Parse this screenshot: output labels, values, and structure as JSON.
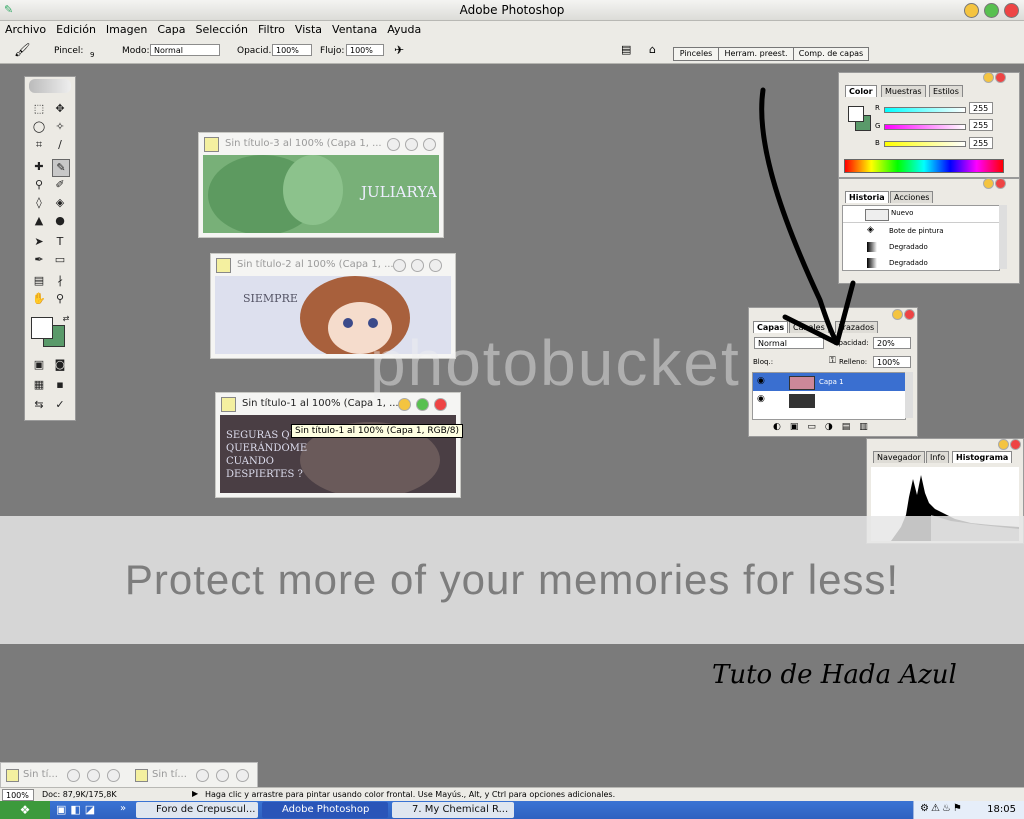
{
  "app": {
    "title": "Adobe Photoshop"
  },
  "menu": [
    "Archivo",
    "Edición",
    "Imagen",
    "Capa",
    "Selección",
    "Filtro",
    "Vista",
    "Ventana",
    "Ayuda"
  ],
  "options": {
    "pincel_label": "Pincel:",
    "pincel_size": "9",
    "modo_label": "Modo:",
    "modo_value": "Normal",
    "opacidad_label": "Opacid.:",
    "opacidad_value": "100%",
    "flujo_label": "Flujo:",
    "flujo_value": "100%",
    "well_tabs": [
      "Pinceles",
      "Herram. preest.",
      "Comp. de capas"
    ]
  },
  "documents": [
    {
      "title": "Sin título-3 al 100% (Capa 1, ...",
      "text": "JULIARYA"
    },
    {
      "title": "Sin título-2 al 100% (Capa 1, ...",
      "text": "SIEMPRE"
    },
    {
      "title": "Sin título-1 al 100% (Capa 1, ...",
      "text": "SEGURAS QUE ME QUERÁNDOME CUANDO DESPIERTES ?"
    }
  ],
  "tooltip": "Sin título-1 al 100% (Capa 1, RGB/8)",
  "color_panel": {
    "tabs": [
      "Color",
      "Muestras",
      "Estilos"
    ],
    "channels": [
      {
        "label": "R",
        "value": "255",
        "color": "#ff0000"
      },
      {
        "label": "G",
        "value": "255",
        "color": "#00cc00"
      },
      {
        "label": "B",
        "value": "255",
        "color": "#2040ff"
      }
    ]
  },
  "history_panel": {
    "tabs": [
      "Historia",
      "Acciones"
    ],
    "snapshot": "Nuevo",
    "items": [
      "Bote de pintura",
      "Degradado",
      "Degradado"
    ]
  },
  "layers_panel": {
    "tabs": [
      "Capas",
      "Canales",
      "Trazados"
    ],
    "blend_mode": "Normal",
    "opacity_label": "Opacidad:",
    "opacity_value": "20%",
    "lock_label": "Bloq.:",
    "fill_label": "Relleno:",
    "fill_value": "100%",
    "layers": [
      {
        "name": "Capa 1",
        "selected": true
      },
      {
        "name": "",
        "selected": false
      }
    ]
  },
  "histogram_panel": {
    "tabs": [
      "Navegador",
      "Info",
      "Histograma"
    ]
  },
  "minimized": [
    "Sin tí...",
    "Sin tí..."
  ],
  "statusbar": {
    "zoom": "100%",
    "doc": "Doc: 87,9K/175,8K",
    "hint": "Haga clic y arrastre para pintar usando color frontal. Use Mayús., Alt, y Ctrl para opciones adicionales."
  },
  "taskbar": {
    "items": [
      "Foro de Crepuscul...",
      "Adobe Photoshop",
      "7. My Chemical R..."
    ],
    "clock": "18:05"
  },
  "watermark": {
    "logo": "photobucket",
    "text": "Protect more of your memories for less!"
  },
  "signature": "Tuto de Hada Azul"
}
